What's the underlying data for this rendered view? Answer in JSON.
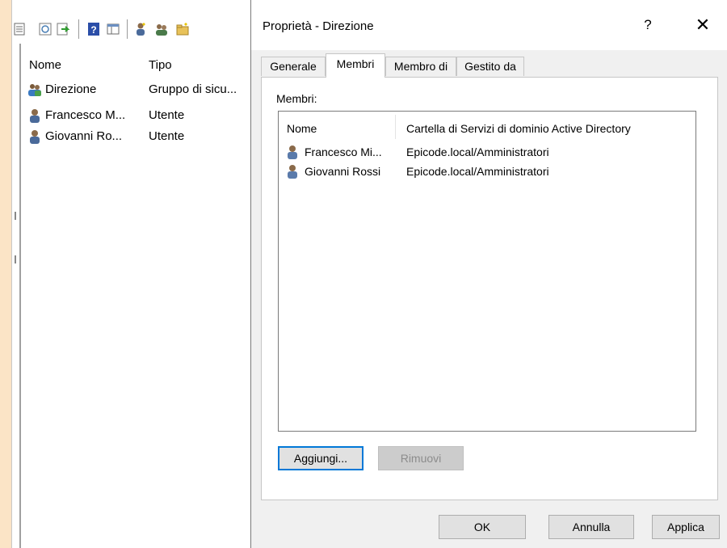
{
  "mmc": {
    "toolbar_icons": [
      "properties-icon",
      "refresh-icon",
      "export-list-icon",
      "help-icon",
      "console-tree-icon",
      "new-user-icon",
      "new-group-icon",
      "new-ou-icon"
    ],
    "list": {
      "columns": [
        "Nome",
        "Tipo"
      ],
      "rows": [
        {
          "name": "Direzione",
          "type": "Gruppo di sicu...",
          "icon": "group-icon"
        },
        {
          "name": "Francesco M...",
          "type": "Utente",
          "icon": "user-icon"
        },
        {
          "name": "Giovanni Ro...",
          "type": "Utente",
          "icon": "user-icon"
        }
      ]
    }
  },
  "dialog": {
    "title": "Proprietà - Direzione",
    "help_label": "?",
    "close_label": "✕",
    "tabs": [
      {
        "label": "Generale",
        "active": false
      },
      {
        "label": "Membri",
        "active": true
      },
      {
        "label": "Membro di",
        "active": false
      },
      {
        "label": "Gestito da",
        "active": false
      }
    ],
    "members_label": "Membri:",
    "members": {
      "columns": [
        "Nome",
        "Cartella di Servizi di dominio Active Directory"
      ],
      "rows": [
        {
          "name": "Francesco Mi...",
          "folder": "Epicode.local/Amministratori"
        },
        {
          "name": "Giovanni Rossi",
          "folder": "Epicode.local/Amministratori"
        }
      ]
    },
    "add_label": "Aggiungi...",
    "remove_label": "Rimuovi",
    "ok_label": "OK",
    "cancel_label": "Annulla",
    "apply_label": "Applica"
  },
  "colors": {
    "desktop": "#fbe4c6",
    "focus_border": "#0078d7",
    "dialog_bg": "#f0f0f0"
  }
}
